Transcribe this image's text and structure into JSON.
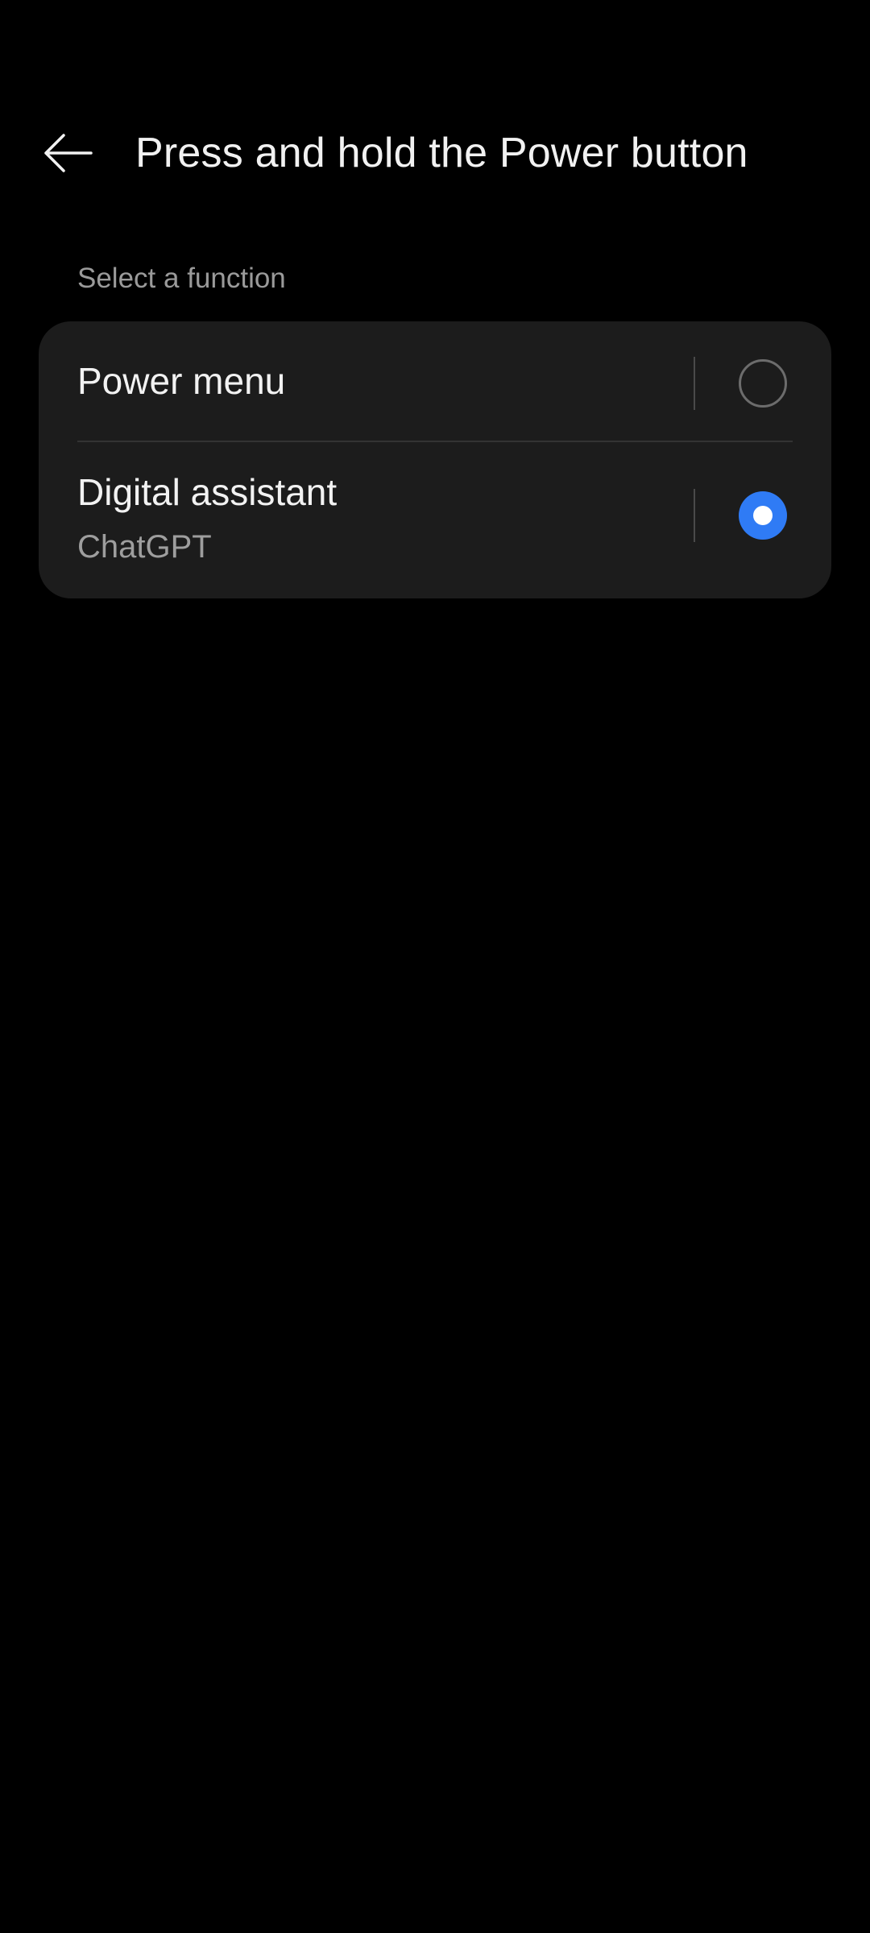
{
  "header": {
    "back_icon": "arrow-left-icon",
    "title": "Press and hold the Power button"
  },
  "section": {
    "label": "Select a function"
  },
  "options": [
    {
      "title": "Power menu",
      "selected": false
    },
    {
      "title": "Digital assistant",
      "subtitle": "ChatGPT",
      "selected": true
    }
  ],
  "colors": {
    "background": "#000000",
    "card": "#1c1c1c",
    "accent": "#2f7bf5",
    "text_primary": "#f2f2f2",
    "text_secondary": "#9e9e9e"
  }
}
